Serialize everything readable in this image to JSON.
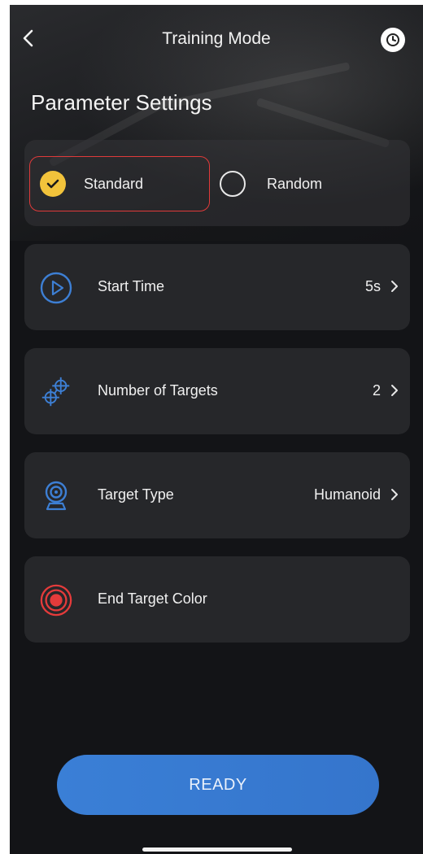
{
  "header": {
    "title": "Training Mode",
    "back_icon": "chevron-left-icon",
    "history_icon": "clock-icon"
  },
  "section": {
    "title": "Parameter Settings"
  },
  "mode": {
    "options": [
      {
        "label": "Standard",
        "selected": true
      },
      {
        "label": "Random",
        "selected": false
      }
    ]
  },
  "settings": [
    {
      "label": "Start Time",
      "value": "5s",
      "icon": "play-circle-icon"
    },
    {
      "label": "Number of Targets",
      "value": "2",
      "icon": "crosshair-targets-icon"
    },
    {
      "label": "Target Type",
      "value": "Humanoid",
      "icon": "webcam-target-icon"
    },
    {
      "label": "End Target Color",
      "value": "",
      "icon": "red-target-icon"
    }
  ],
  "actions": {
    "ready_label": "READY"
  },
  "colors": {
    "background": "#131417",
    "card": "#28292d",
    "selected": "#f2c33b",
    "highlight_border": "#e03a3a",
    "accent_blue": "#3a7fd6",
    "target_red": "#e53b3b"
  }
}
